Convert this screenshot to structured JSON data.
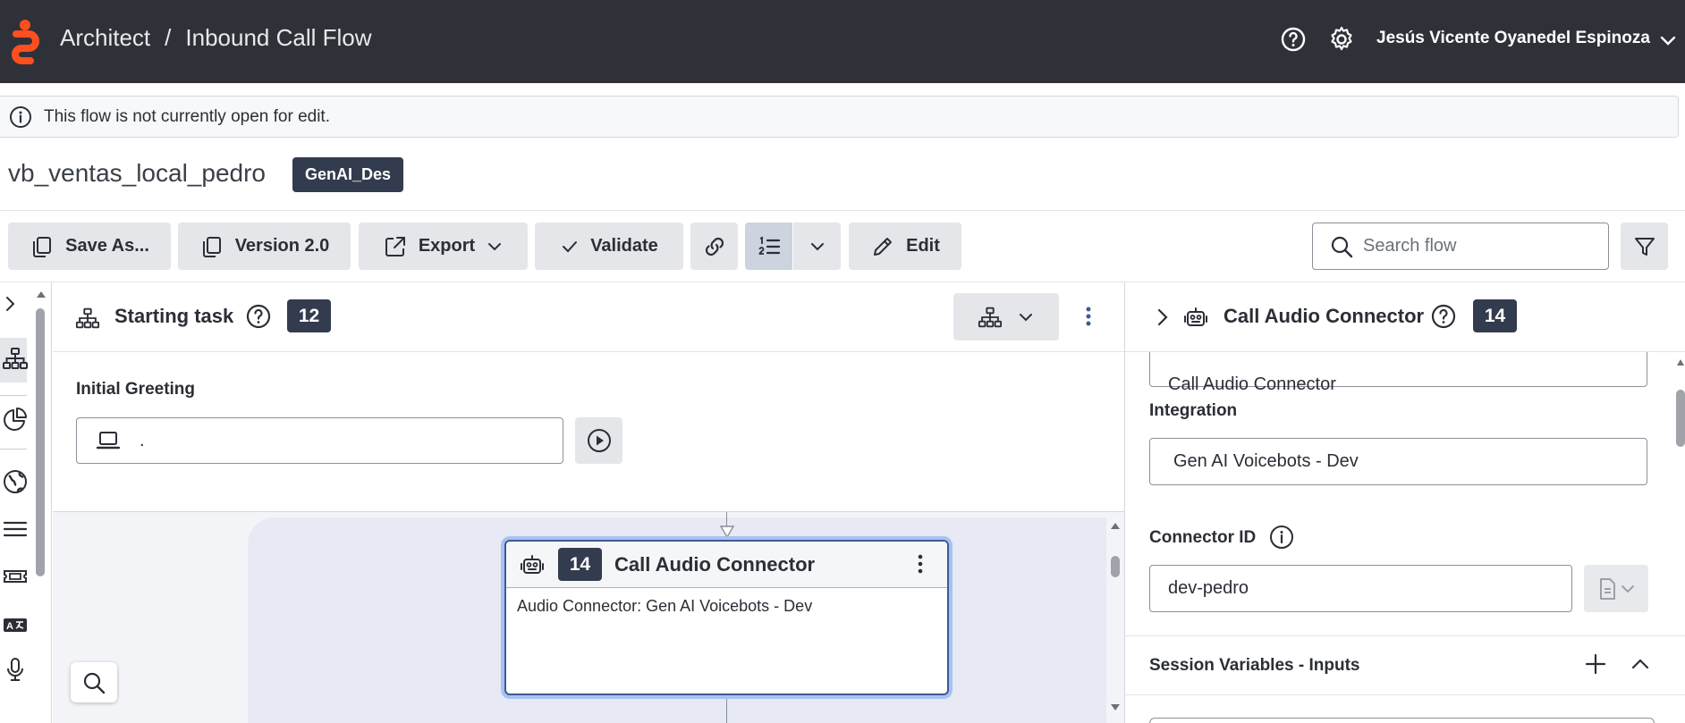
{
  "header": {
    "app_name": "Architect",
    "separator": "/",
    "flow_type": "Inbound Call Flow",
    "user_name": "Jesús Vicente Oyanedel Espinoza"
  },
  "notice": {
    "text": "This flow is not currently open for edit."
  },
  "flow": {
    "name": "vb_ventas_local_pedro",
    "badge": "GenAI_Des"
  },
  "toolbar": {
    "save_as": "Save As...",
    "version": "Version 2.0",
    "export": "Export",
    "validate": "Validate",
    "edit": "Edit",
    "search_placeholder": "Search flow"
  },
  "task": {
    "title": "Starting task",
    "count": "12",
    "greeting_label": "Initial Greeting",
    "greeting_value": "."
  },
  "node": {
    "count": "14",
    "title": "Call Audio Connector",
    "body": "Audio Connector: Gen AI Voicebots - Dev"
  },
  "details": {
    "title": "Call Audio Connector",
    "count": "14",
    "name_value_partial": "Call Audio Connector",
    "integration_label": "Integration",
    "integration_value": "Gen AI Voicebots - Dev",
    "connector_label": "Connector ID",
    "connector_value": "dev-pedro",
    "session_label": "Session Variables - Inputs"
  },
  "colors": {
    "header_bg": "#2e3238",
    "logo_orange": "#ff4f1f",
    "badge_bg": "#333c4e",
    "selection_blue": "#3c5a96"
  }
}
